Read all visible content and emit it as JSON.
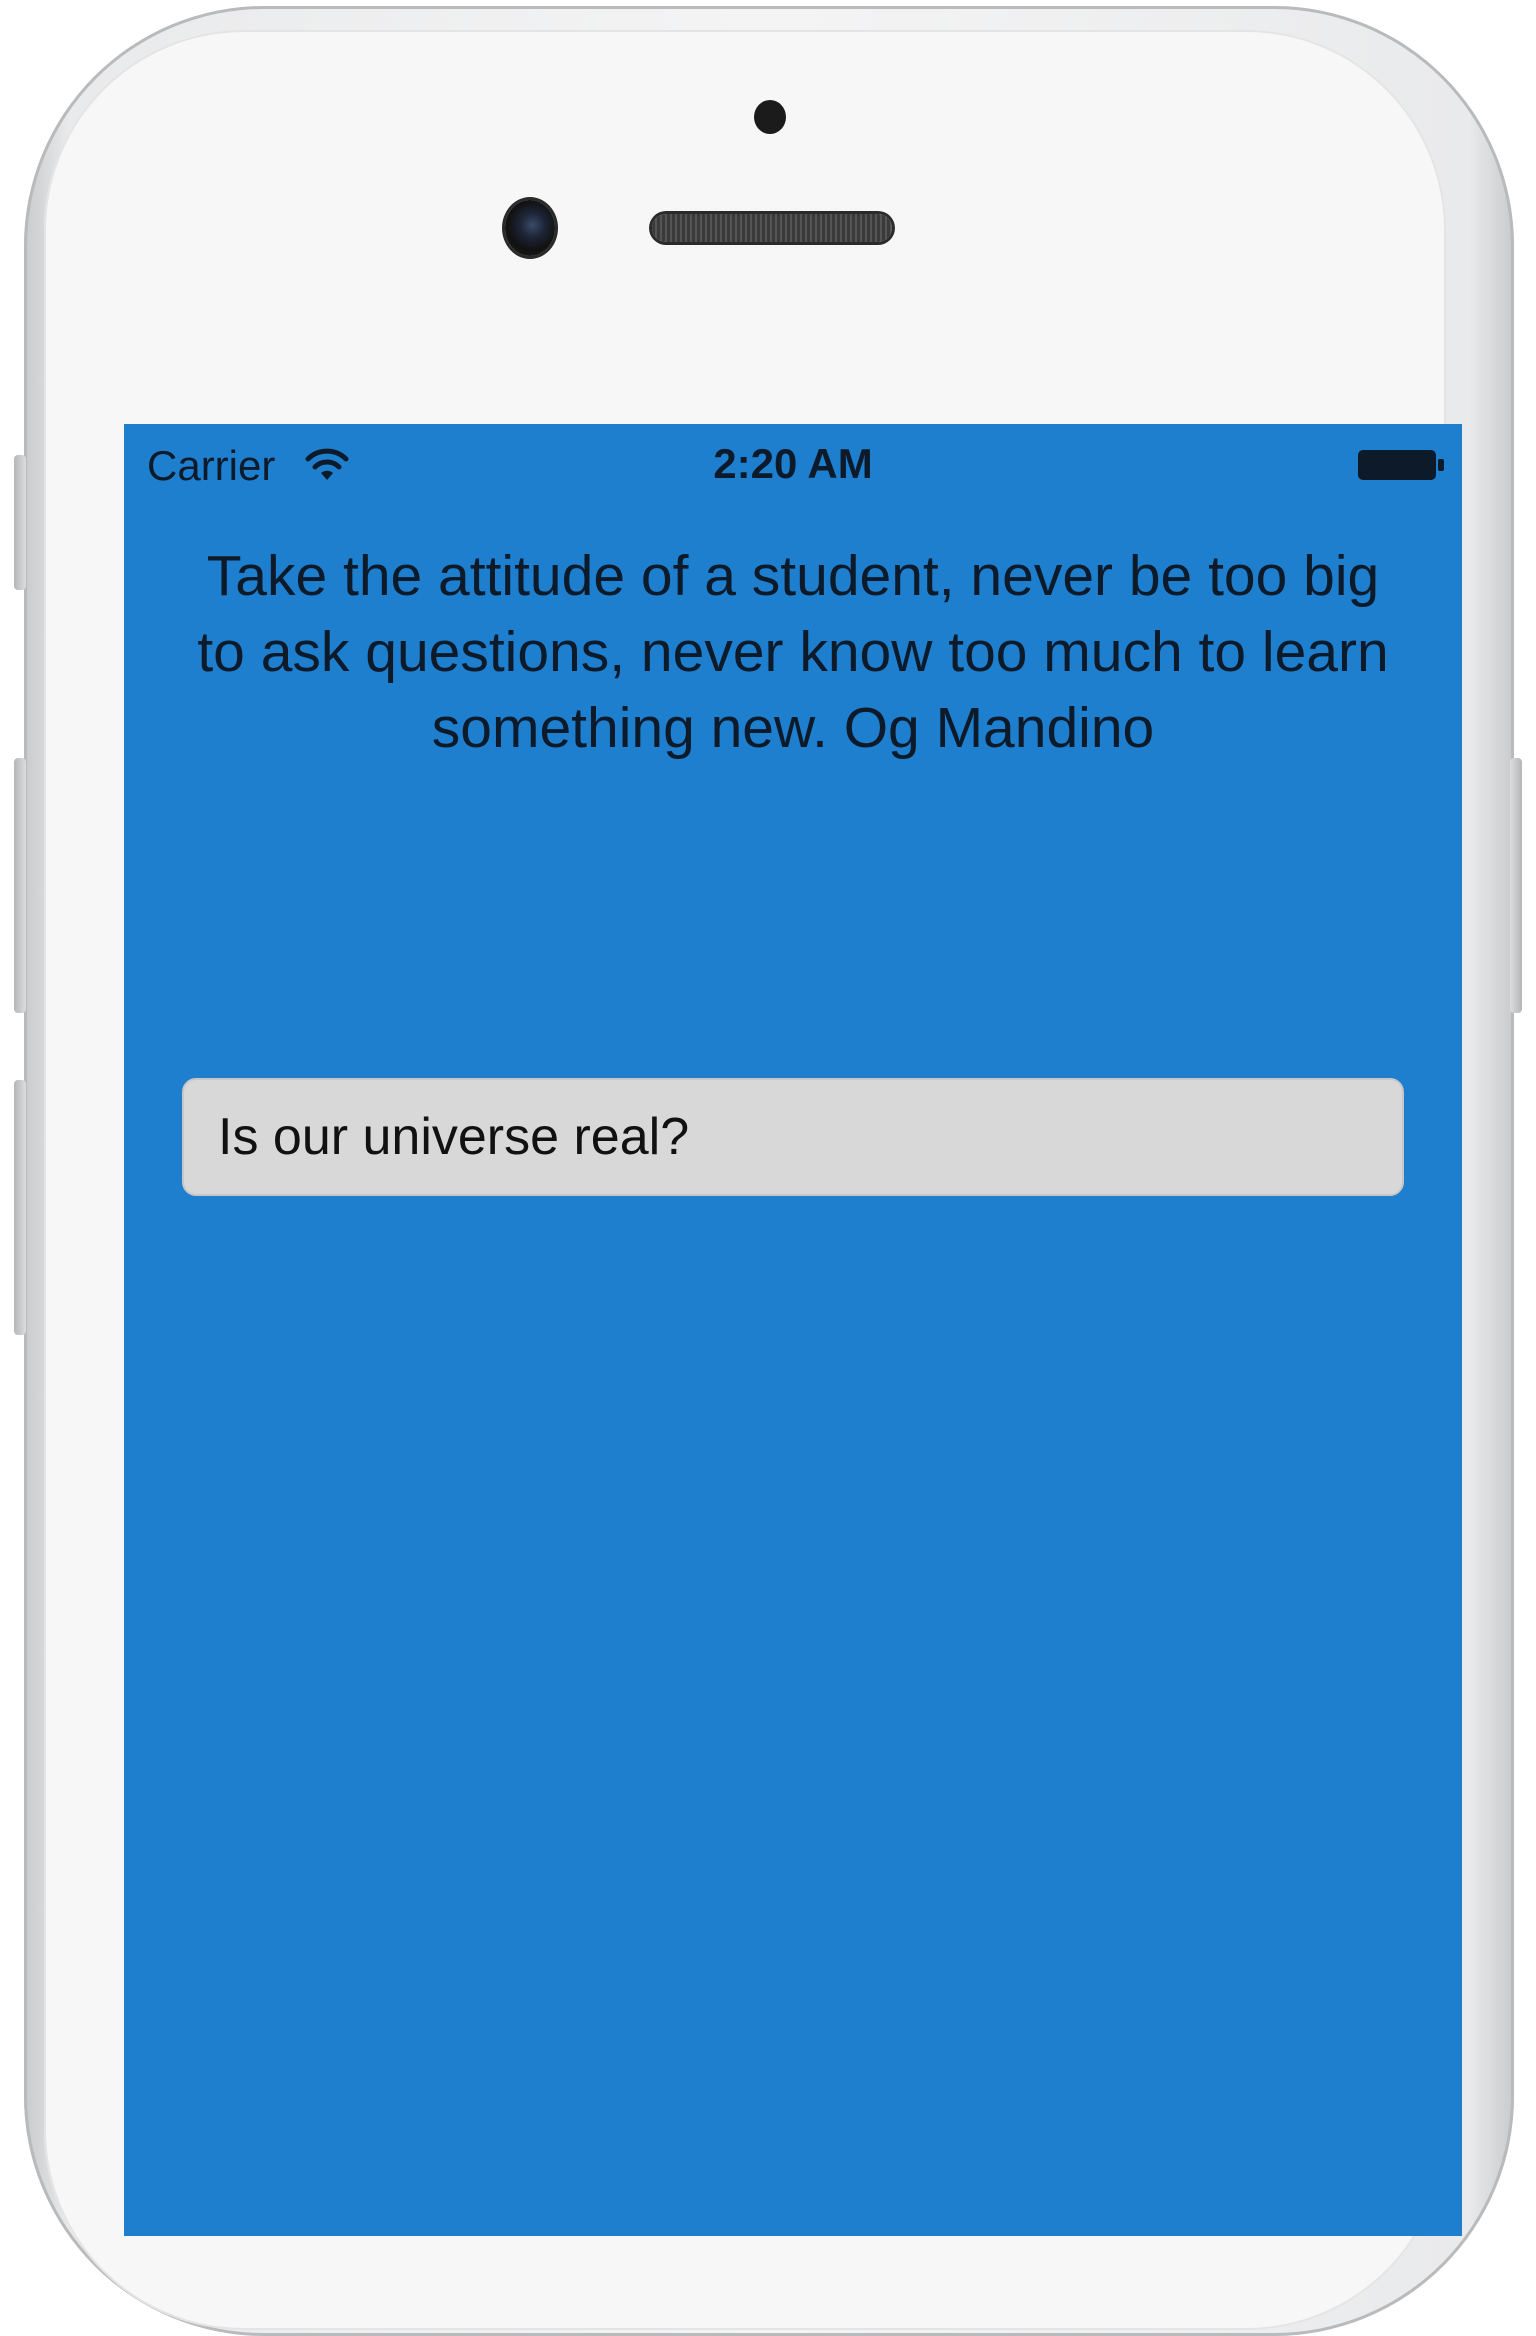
{
  "status_bar": {
    "carrier": "Carrier",
    "time": "2:20 AM",
    "wifi_icon": "wifi-icon",
    "battery_icon": "battery-icon"
  },
  "quote": {
    "text": "Take the attitude of a student, never be too big to ask questions, never know too much to learn something new. Og Mandino"
  },
  "question_input": {
    "value": "Is our universe real?"
  },
  "colors": {
    "screen_background": "#1e7fcf",
    "input_background": "#d8d8d8",
    "text": "#0d1a2a"
  }
}
